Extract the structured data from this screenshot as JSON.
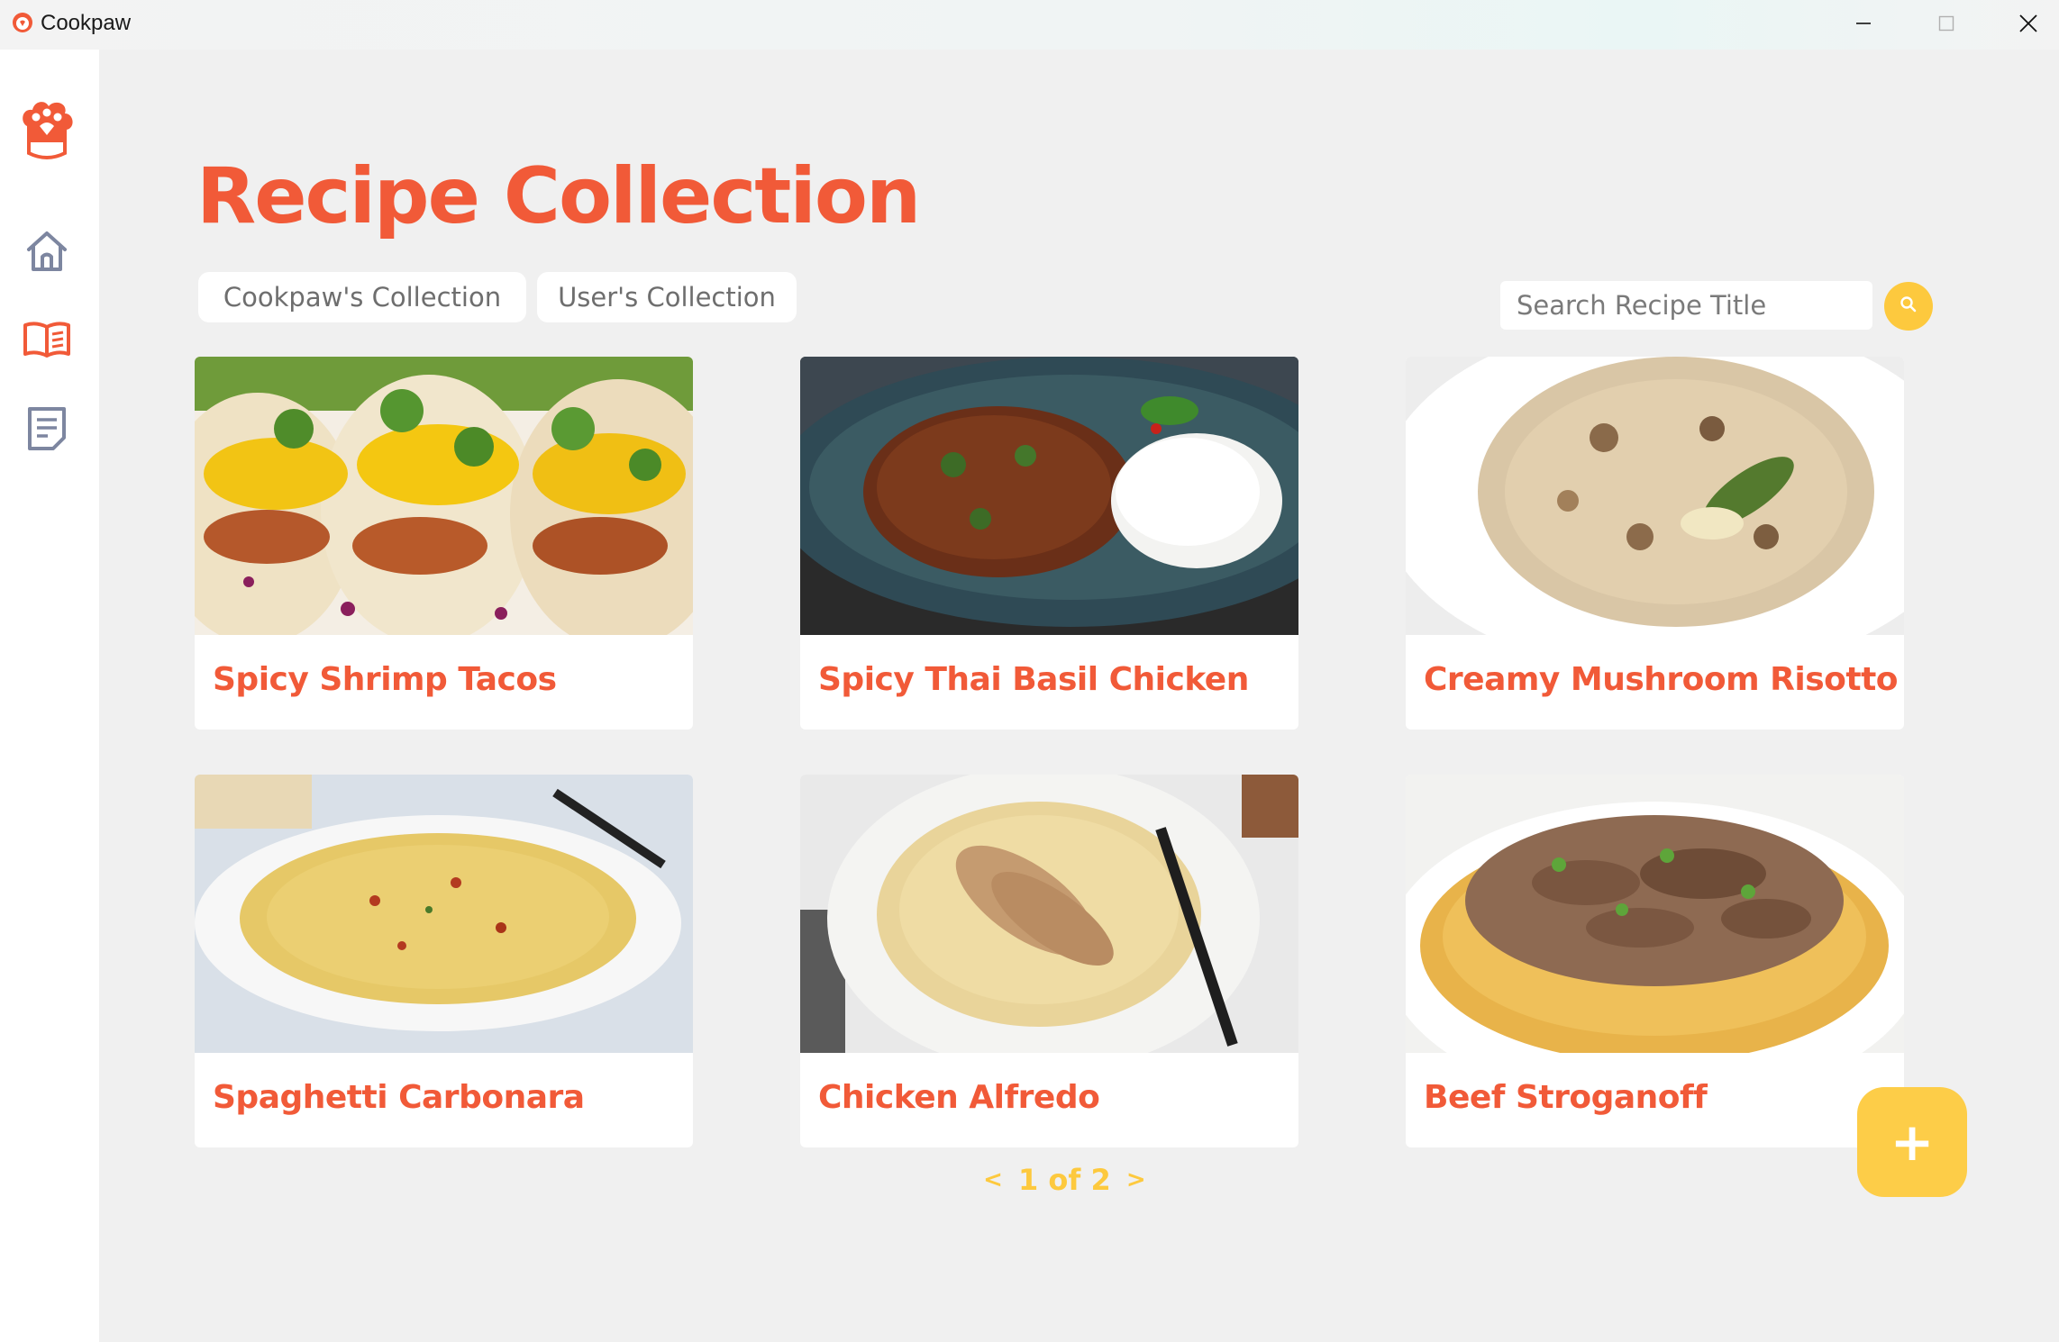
{
  "window": {
    "title": "Cookpaw",
    "controls": [
      "minimize-icon",
      "maximize-icon",
      "close-icon"
    ]
  },
  "sidebar": {
    "logo": "paw-chef-logo-icon",
    "items": [
      {
        "name": "home",
        "icon": "home-icon"
      },
      {
        "name": "recipes",
        "icon": "book-icon"
      },
      {
        "name": "notes",
        "icon": "notes-icon"
      }
    ]
  },
  "main": {
    "title": "Recipe Collection",
    "tabs": [
      {
        "label": "Cookpaw's Collection"
      },
      {
        "label": "User's Collection"
      }
    ],
    "search": {
      "placeholder": "Search Recipe Title",
      "value": "",
      "button_icon": "search-icon"
    },
    "recipes": [
      {
        "title": "Spicy Shrimp Tacos"
      },
      {
        "title": "Spicy Thai Basil Chicken"
      },
      {
        "title": "Creamy Mushroom Risotto"
      },
      {
        "title": "Spaghetti Carbonara"
      },
      {
        "title": "Chicken Alfredo"
      },
      {
        "title": "Beef Stroganoff"
      }
    ],
    "pagination": {
      "prev": "<",
      "text": "1 of 2",
      "next": ">"
    },
    "fab_label": "+"
  },
  "colors": {
    "accent": "#f15a38",
    "yellow": "#fdc93e",
    "background": "#f0f0f0",
    "sidebar": "#ffffff"
  }
}
